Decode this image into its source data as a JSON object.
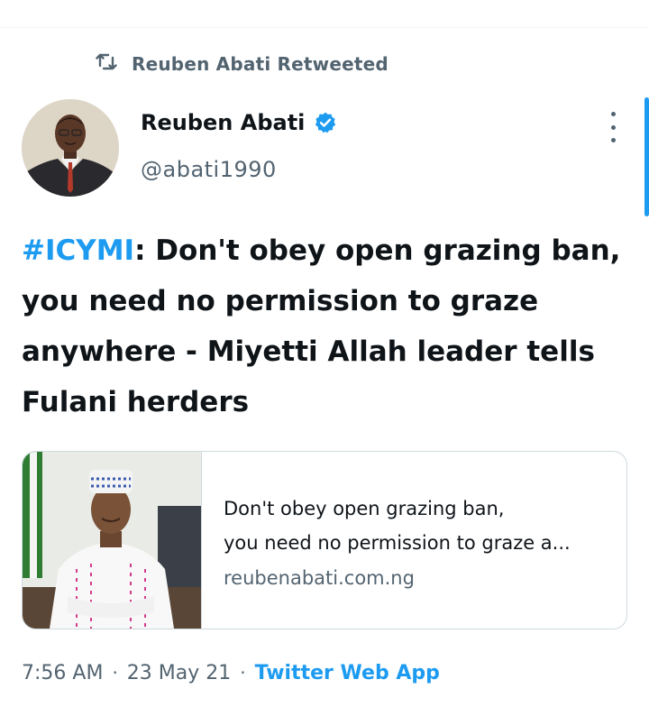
{
  "retweet_context": {
    "text": "Reuben Abati Retweeted",
    "icon": "retweet-icon"
  },
  "author": {
    "name": "Reuben Abati",
    "handle": "@abati1990",
    "verified": true
  },
  "tweet": {
    "hashtag": "#ICYMI",
    "body": ": Don't obey open grazing ban, you need no permission to graze anywhere - Miyetti Allah leader tells Fulani herders"
  },
  "link_card": {
    "title_line1": "Don't obey open grazing ban,",
    "title_line2": "you need no permission to graze a...",
    "domain": "reubenabati.com.ng"
  },
  "meta": {
    "time": "7:56 AM",
    "separator": "·",
    "date": "23 May 21",
    "source": "Twitter Web App"
  },
  "colors": {
    "accent": "#1d9bf0",
    "secondary_text": "#536471",
    "border": "#cfd9de"
  }
}
